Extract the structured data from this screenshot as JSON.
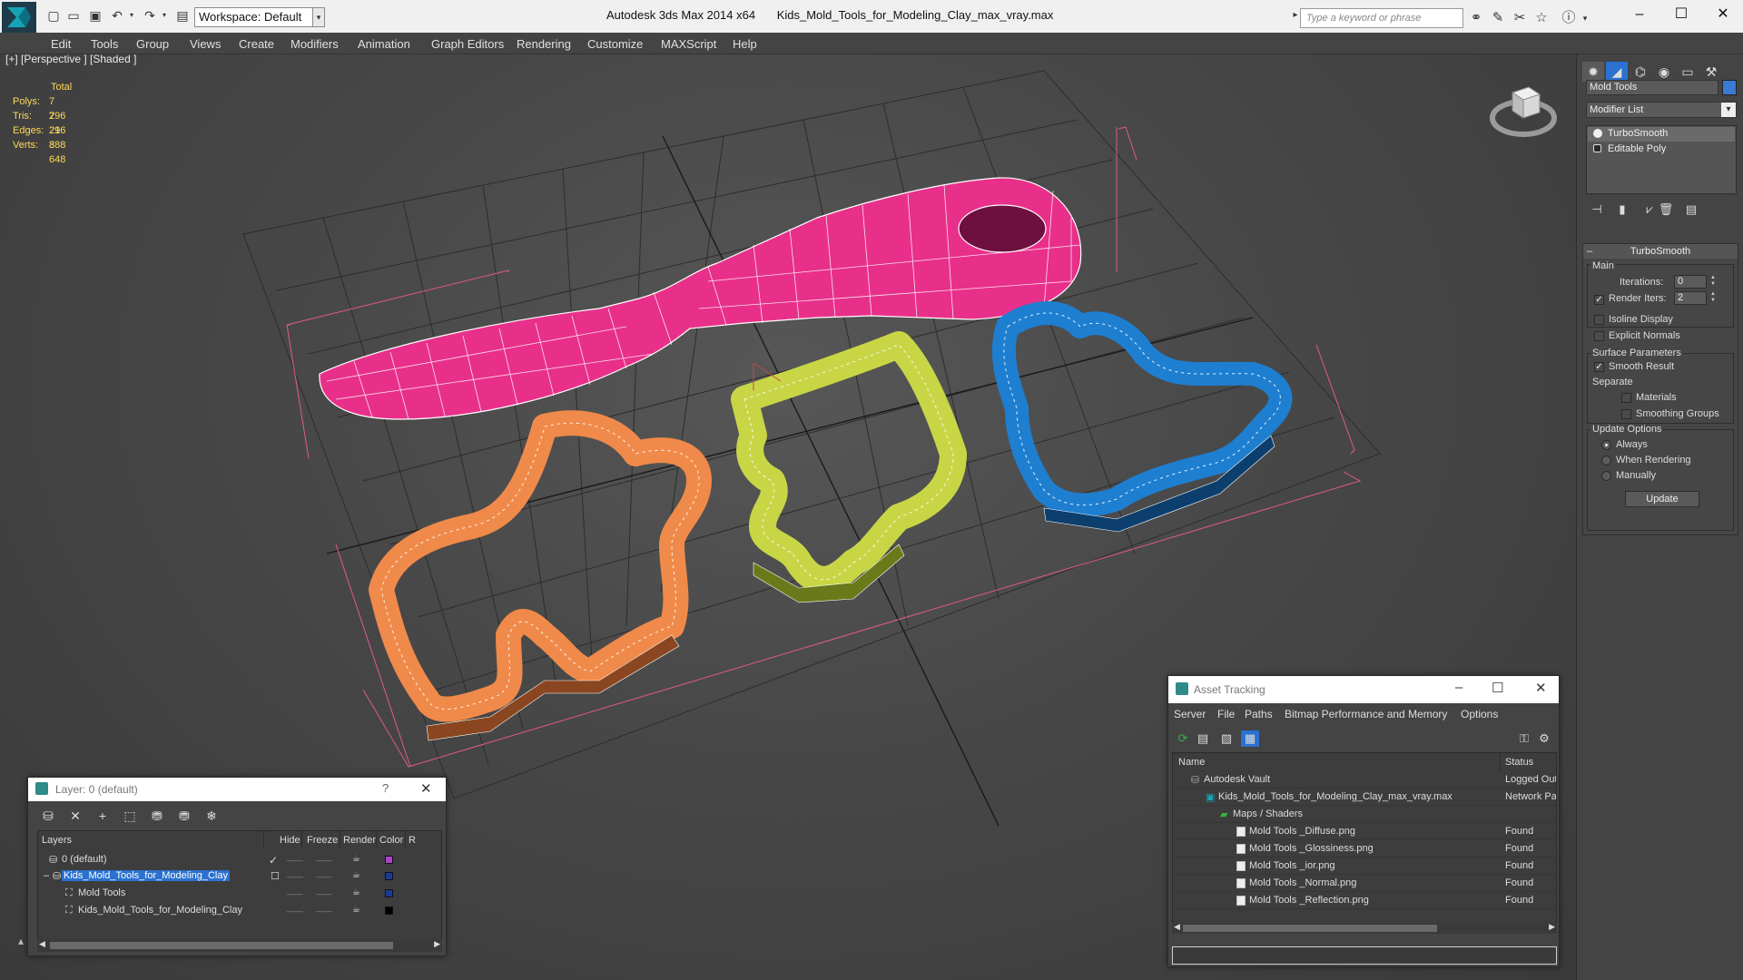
{
  "titlebar": {
    "workspace": "Workspace: Default",
    "app_name": "Autodesk 3ds Max  2014 x64",
    "file_name": "Kids_Mold_Tools_for_Modeling_Clay_max_vray.max",
    "search_placeholder": "Type a keyword or phrase",
    "icons": [
      "new-icon",
      "open-icon",
      "save-icon",
      "undo-icon",
      "redo-icon",
      "project-icon",
      "binoculars-icon",
      "search-icon",
      "star-icon",
      "help-icon"
    ]
  },
  "menu": [
    "Edit",
    "Tools",
    "Group",
    "Views",
    "Create",
    "Modifiers",
    "Animation",
    "Graph Editors",
    "Rendering",
    "Customize",
    "MAXScript",
    "Help"
  ],
  "viewport": {
    "label": "[+] [Perspective ] [Shaded ]",
    "stats": {
      "header": "Total",
      "rows": [
        {
          "label": "Polys:",
          "value": "7 296"
        },
        {
          "label": "Tris:",
          "value": "7 296"
        },
        {
          "label": "Edges:",
          "value": "21 888"
        },
        {
          "label": "Verts:",
          "value": "3 648"
        }
      ]
    },
    "colors": {
      "knife": "#e8308a",
      "orange": "#f08a4a",
      "yellow": "#c8d646",
      "blue": "#1e7fd0"
    }
  },
  "command_panel": {
    "object_name": "Mold Tools",
    "modifier_list": "Modifier List",
    "stack": [
      "TurboSmooth",
      "Editable Poly"
    ],
    "rollout_title": "TurboSmooth",
    "main_label": "Main",
    "iterations_label": "Iterations:",
    "iterations_value": "0",
    "render_iters_label": "Render Iters:",
    "render_iters_value": "2",
    "isoline_label": "Isoline Display",
    "explicit_normals_label": "Explicit Normals",
    "surface_params_label": "Surface Parameters",
    "smooth_result_label": "Smooth Result",
    "separate_label": "Separate",
    "materials_label": "Materials",
    "smoothing_groups_label": "Smoothing Groups",
    "update_options_label": "Update Options",
    "always_label": "Always",
    "when_rendering_label": "When Rendering",
    "manually_label": "Manually",
    "update_button": "Update"
  },
  "layer_dialog": {
    "title": "Layer: 0 (default)",
    "help": "?",
    "columns": [
      "Layers",
      "Hide",
      "Freeze",
      "Render",
      "Color",
      "R"
    ],
    "rows": [
      {
        "name": "0 (default)",
        "color": "#b040d0"
      },
      {
        "name": "Kids_Mold_Tools_for_Modeling_Clay",
        "color": "#1a3a9a"
      },
      {
        "name": "Mold Tools",
        "color": "#1a3a9a"
      },
      {
        "name": "Kids_Mold_Tools_for_Modeling_Clay",
        "color": "#000000"
      }
    ]
  },
  "asset_dialog": {
    "title": "Asset Tracking",
    "menu": [
      "Server",
      "File",
      "Paths",
      "Bitmap Performance and Memory",
      "Options"
    ],
    "columns": [
      "Name",
      "Status"
    ],
    "rows": [
      {
        "name": "Autodesk Vault",
        "status": "Logged Out"
      },
      {
        "name": "Kids_Mold_Tools_for_Modeling_Clay_max_vray.max",
        "status": "Network Pa"
      },
      {
        "name": "Maps / Shaders",
        "status": ""
      },
      {
        "name": "Mold Tools _Diffuse.png",
        "status": "Found"
      },
      {
        "name": "Mold Tools _Glossiness.png",
        "status": "Found"
      },
      {
        "name": "Mold Tools _ior.png",
        "status": "Found"
      },
      {
        "name": "Mold Tools _Normal.png",
        "status": "Found"
      },
      {
        "name": "Mold Tools _Reflection.png",
        "status": "Found"
      }
    ]
  }
}
